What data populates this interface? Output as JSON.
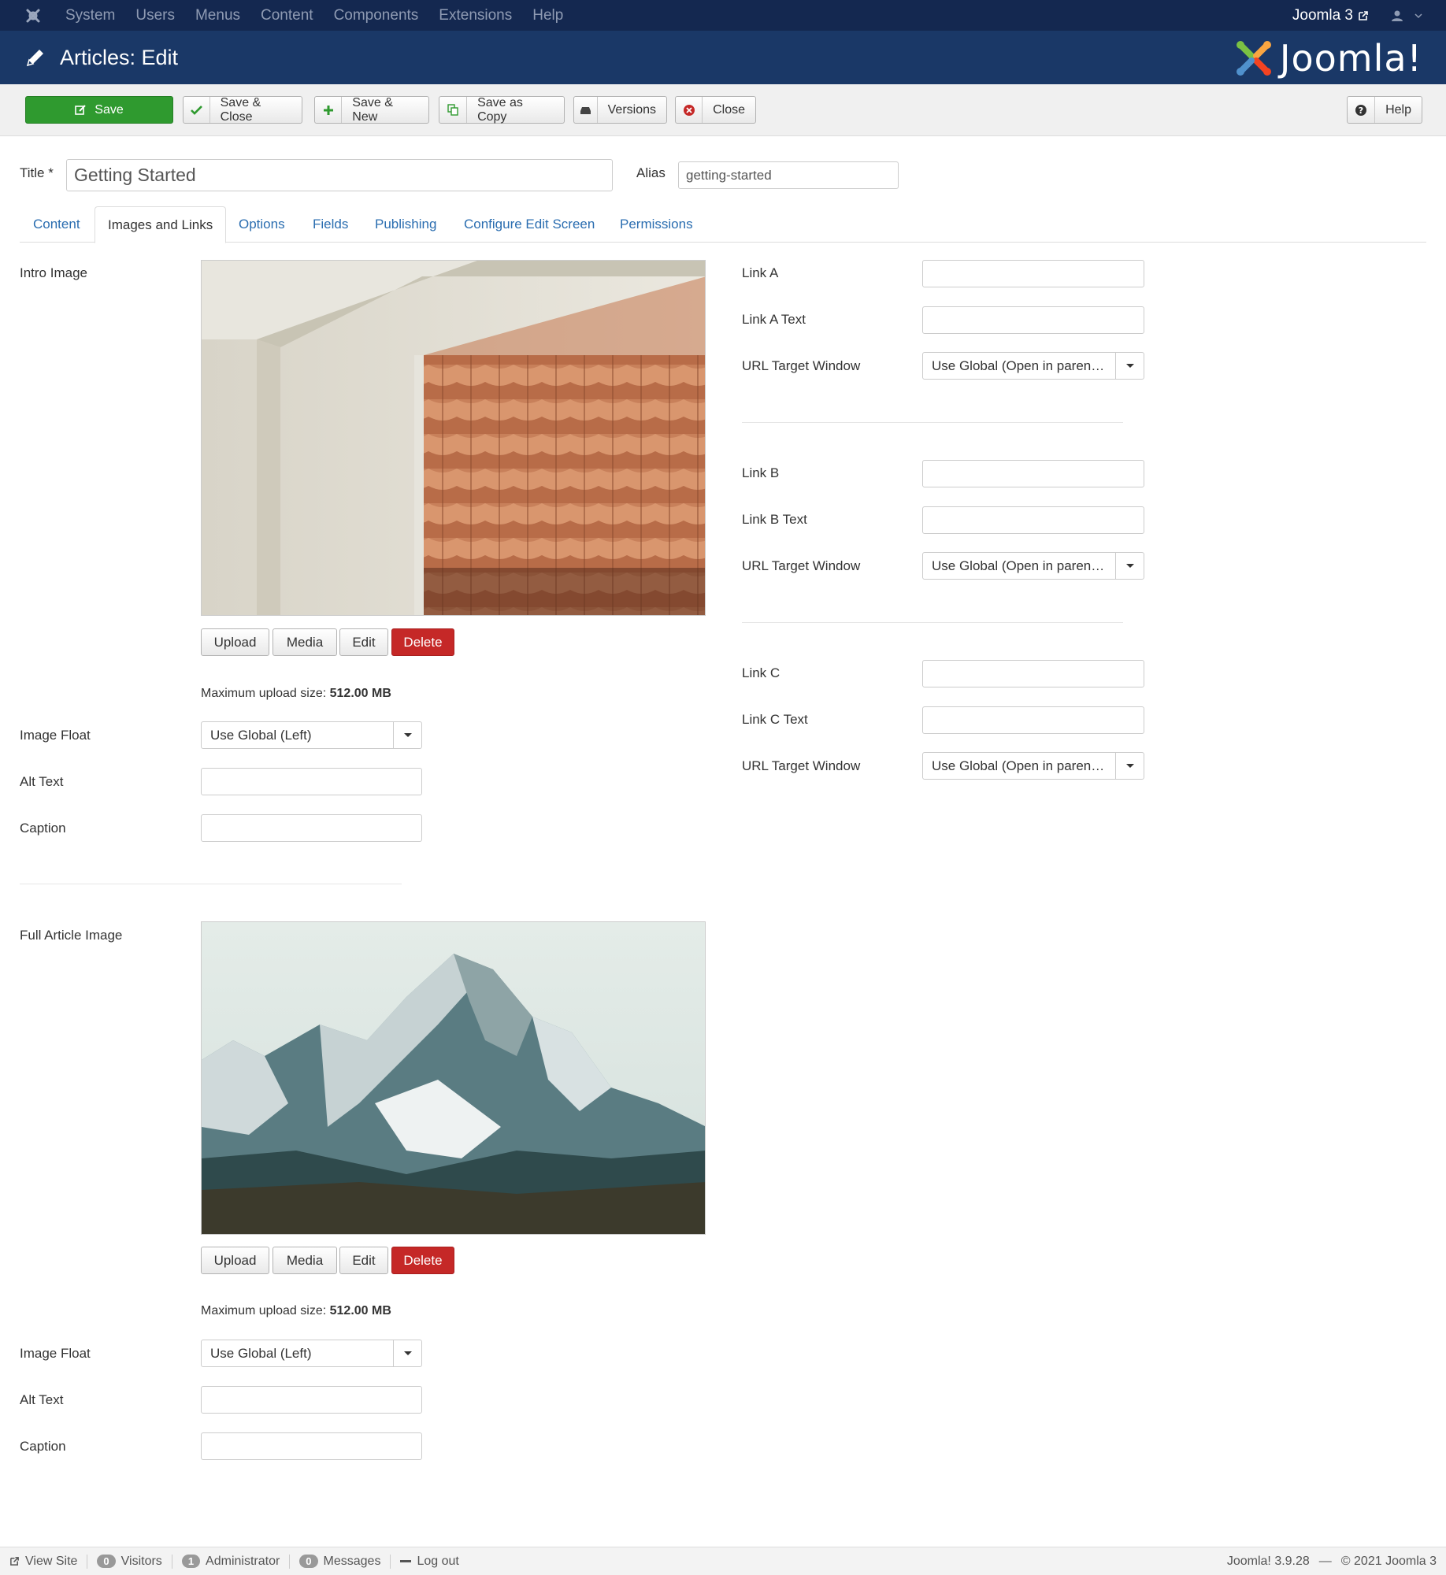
{
  "topbar": {
    "menu": [
      "System",
      "Users",
      "Menus",
      "Content",
      "Components",
      "Extensions",
      "Help"
    ],
    "site_link": "Joomla 3"
  },
  "header": {
    "title": "Articles: Edit",
    "brand": "Joomla!"
  },
  "toolbar": {
    "save": "Save",
    "save_close": "Save & Close",
    "save_new": "Save & New",
    "save_copy": "Save as Copy",
    "versions": "Versions",
    "close": "Close",
    "help": "Help"
  },
  "form": {
    "title_label": "Title *",
    "title_value": "Getting Started",
    "alias_label": "Alias",
    "alias_value": "getting-started"
  },
  "tabs": [
    "Content",
    "Images and Links",
    "Options",
    "Fields",
    "Publishing",
    "Configure Edit Screen",
    "Permissions"
  ],
  "active_tab": "Images and Links",
  "intro": {
    "label": "Intro Image",
    "buttons": {
      "upload": "Upload",
      "media": "Media",
      "edit": "Edit",
      "delete": "Delete"
    },
    "upload_note_prefix": "Maximum upload size: ",
    "upload_note_value": "512.00 MB",
    "float_label": "Image Float",
    "float_value": "Use Global (Left)",
    "alt_label": "Alt Text",
    "caption_label": "Caption"
  },
  "full": {
    "label": "Full Article Image",
    "buttons": {
      "upload": "Upload",
      "media": "Media",
      "edit": "Edit",
      "delete": "Delete"
    },
    "upload_note_prefix": "Maximum upload size: ",
    "upload_note_value": "512.00 MB",
    "float_label": "Image Float",
    "float_value": "Use Global (Left)",
    "alt_label": "Alt Text",
    "caption_label": "Caption"
  },
  "links": {
    "link_a": "Link A",
    "link_a_text": "Link A Text",
    "target_a": "URL Target Window",
    "target_a_value": "Use Global (Open in parent w…",
    "link_b": "Link B",
    "link_b_text": "Link B Text",
    "target_b": "URL Target Window",
    "target_b_value": "Use Global (Open in parent w…",
    "link_c": "Link C",
    "link_c_text": "Link C Text",
    "target_c": "URL Target Window",
    "target_c_value": "Use Global (Open in parent w…"
  },
  "statusbar": {
    "view_site": "View Site",
    "visitors_count": "0",
    "visitors": "Visitors",
    "admin_count": "1",
    "admin": "Administrator",
    "messages_count": "0",
    "messages": "Messages",
    "logout": "Log out",
    "version": "Joomla! 3.9.28",
    "separator": "—",
    "copyright": "© 2021 Joomla 3"
  },
  "colors": {
    "topbar": "#142850",
    "header": "#1a3867",
    "save_green": "#2f9a2f",
    "delete_red": "#c52827",
    "link_blue": "#2a6db0"
  }
}
